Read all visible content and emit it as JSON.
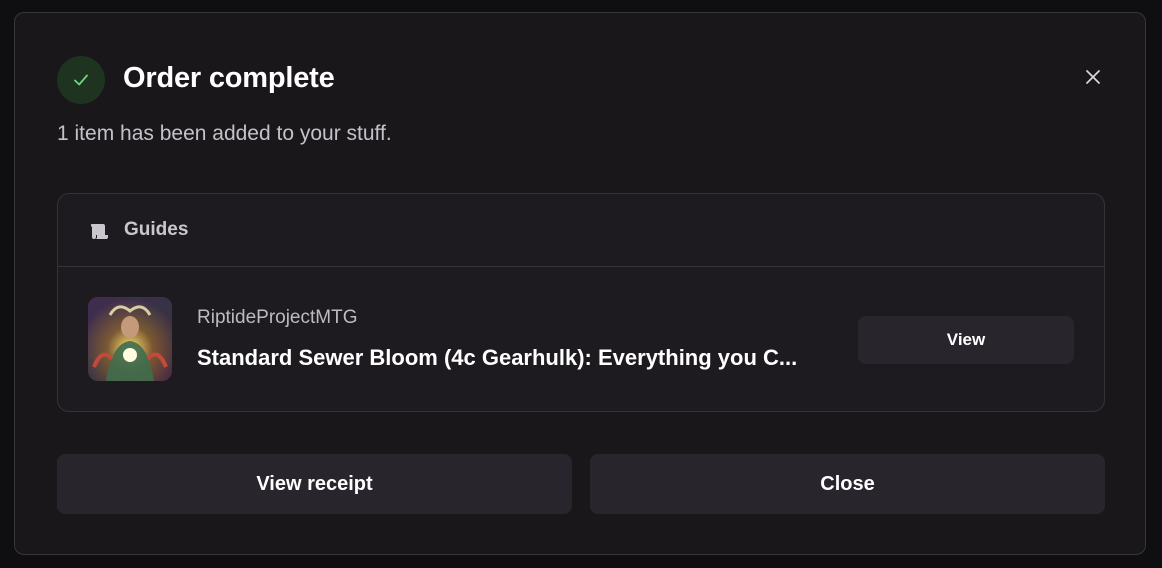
{
  "modal": {
    "title": "Order complete",
    "subtitle": "1 item has been added to your stuff.",
    "status_icon": "check-icon",
    "close_icon": "close-icon"
  },
  "card": {
    "section_label": "Guides",
    "section_icon": "scroll-icon",
    "item": {
      "author": "RiptideProjectMTG",
      "title": "Standard Sewer Bloom (4c Gearhulk): Everything you C...",
      "view_label": "View"
    }
  },
  "footer": {
    "receipt_label": "View receipt",
    "close_label": "Close"
  },
  "colors": {
    "background": "#19171a",
    "card": "#1d1b20",
    "button": "#28262c",
    "success_bg": "#1e3320",
    "success": "#5fd068"
  }
}
